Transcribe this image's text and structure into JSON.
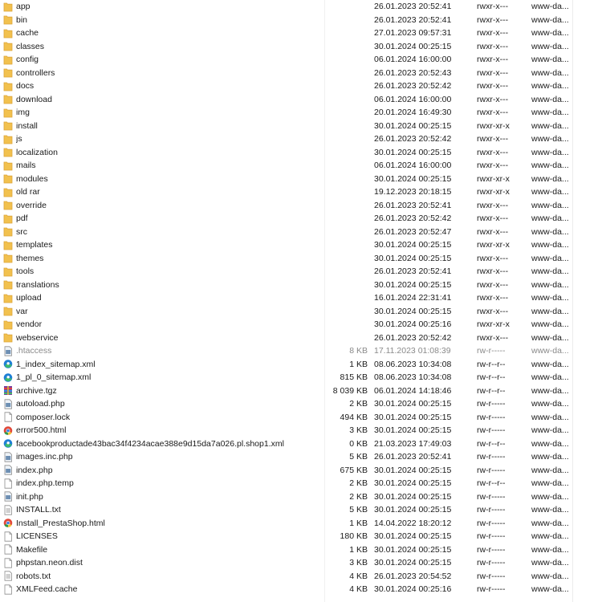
{
  "files": [
    {
      "name": "app",
      "size": "",
      "date": "26.01.2023 20:52:41",
      "perm": "rwxr-x---",
      "owner": "www-da...",
      "icon": "folder-icon"
    },
    {
      "name": "bin",
      "size": "",
      "date": "26.01.2023 20:52:41",
      "perm": "rwxr-x---",
      "owner": "www-da...",
      "icon": "folder-icon"
    },
    {
      "name": "cache",
      "size": "",
      "date": "27.01.2023 09:57:31",
      "perm": "rwxr-x---",
      "owner": "www-da...",
      "icon": "folder-icon"
    },
    {
      "name": "classes",
      "size": "",
      "date": "30.01.2024 00:25:15",
      "perm": "rwxr-x---",
      "owner": "www-da...",
      "icon": "folder-icon"
    },
    {
      "name": "config",
      "size": "",
      "date": "06.01.2024 16:00:00",
      "perm": "rwxr-x---",
      "owner": "www-da...",
      "icon": "folder-icon"
    },
    {
      "name": "controllers",
      "size": "",
      "date": "26.01.2023 20:52:43",
      "perm": "rwxr-x---",
      "owner": "www-da...",
      "icon": "folder-icon"
    },
    {
      "name": "docs",
      "size": "",
      "date": "26.01.2023 20:52:42",
      "perm": "rwxr-x---",
      "owner": "www-da...",
      "icon": "folder-icon"
    },
    {
      "name": "download",
      "size": "",
      "date": "06.01.2024 16:00:00",
      "perm": "rwxr-x---",
      "owner": "www-da...",
      "icon": "folder-icon"
    },
    {
      "name": "img",
      "size": "",
      "date": "20.01.2024 16:49:30",
      "perm": "rwxr-x---",
      "owner": "www-da...",
      "icon": "folder-icon"
    },
    {
      "name": "install",
      "size": "",
      "date": "30.01.2024 00:25:15",
      "perm": "rwxr-xr-x",
      "owner": "www-da...",
      "icon": "folder-icon"
    },
    {
      "name": "js",
      "size": "",
      "date": "26.01.2023 20:52:42",
      "perm": "rwxr-x---",
      "owner": "www-da...",
      "icon": "folder-icon"
    },
    {
      "name": "localization",
      "size": "",
      "date": "30.01.2024 00:25:15",
      "perm": "rwxr-x---",
      "owner": "www-da...",
      "icon": "folder-icon"
    },
    {
      "name": "mails",
      "size": "",
      "date": "06.01.2024 16:00:00",
      "perm": "rwxr-x---",
      "owner": "www-da...",
      "icon": "folder-icon"
    },
    {
      "name": "modules",
      "size": "",
      "date": "30.01.2024 00:25:15",
      "perm": "rwxr-xr-x",
      "owner": "www-da...",
      "icon": "folder-icon"
    },
    {
      "name": "old rar",
      "size": "",
      "date": "19.12.2023 20:18:15",
      "perm": "rwxr-xr-x",
      "owner": "www-da...",
      "icon": "folder-icon"
    },
    {
      "name": "override",
      "size": "",
      "date": "26.01.2023 20:52:41",
      "perm": "rwxr-x---",
      "owner": "www-da...",
      "icon": "folder-icon"
    },
    {
      "name": "pdf",
      "size": "",
      "date": "26.01.2023 20:52:42",
      "perm": "rwxr-x---",
      "owner": "www-da...",
      "icon": "folder-icon"
    },
    {
      "name": "src",
      "size": "",
      "date": "26.01.2023 20:52:47",
      "perm": "rwxr-x---",
      "owner": "www-da...",
      "icon": "folder-icon"
    },
    {
      "name": "templates",
      "size": "",
      "date": "30.01.2024 00:25:15",
      "perm": "rwxr-xr-x",
      "owner": "www-da...",
      "icon": "folder-icon"
    },
    {
      "name": "themes",
      "size": "",
      "date": "30.01.2024 00:25:15",
      "perm": "rwxr-x---",
      "owner": "www-da...",
      "icon": "folder-icon"
    },
    {
      "name": "tools",
      "size": "",
      "date": "26.01.2023 20:52:41",
      "perm": "rwxr-x---",
      "owner": "www-da...",
      "icon": "folder-icon"
    },
    {
      "name": "translations",
      "size": "",
      "date": "30.01.2024 00:25:15",
      "perm": "rwxr-x---",
      "owner": "www-da...",
      "icon": "folder-icon"
    },
    {
      "name": "upload",
      "size": "",
      "date": "16.01.2024 22:31:41",
      "perm": "rwxr-x---",
      "owner": "www-da...",
      "icon": "folder-icon"
    },
    {
      "name": "var",
      "size": "",
      "date": "30.01.2024 00:25:15",
      "perm": "rwxr-x---",
      "owner": "www-da...",
      "icon": "folder-icon"
    },
    {
      "name": "vendor",
      "size": "",
      "date": "30.01.2024 00:25:16",
      "perm": "rwxr-xr-x",
      "owner": "www-da...",
      "icon": "folder-icon"
    },
    {
      "name": "webservice",
      "size": "",
      "date": "26.01.2023 20:52:42",
      "perm": "rwxr-x---",
      "owner": "www-da...",
      "icon": "folder-icon"
    },
    {
      "name": ".htaccess",
      "size": "8 KB",
      "date": "17.11.2023 01:08:39",
      "perm": "rw-r-----",
      "owner": "www-da...",
      "icon": "generic-file-icon",
      "dimmed": true
    },
    {
      "name": "1_index_sitemap.xml",
      "size": "1 KB",
      "date": "08.06.2023 10:34:08",
      "perm": "rw-r--r--",
      "owner": "www-da...",
      "icon": "edge-browser-icon"
    },
    {
      "name": "1_pl_0_sitemap.xml",
      "size": "815 KB",
      "date": "08.06.2023 10:34:08",
      "perm": "rw-r--r--",
      "owner": "www-da...",
      "icon": "edge-browser-icon"
    },
    {
      "name": "archive.tgz",
      "size": "8 039 KB",
      "date": "06.01.2024 14:18:46",
      "perm": "rw-r--r--",
      "owner": "www-da...",
      "icon": "winrar-archive-icon"
    },
    {
      "name": "autoload.php",
      "size": "2 KB",
      "date": "30.01.2024 00:25:15",
      "perm": "rw-r-----",
      "owner": "www-da...",
      "icon": "generic-file-icon"
    },
    {
      "name": "composer.lock",
      "size": "494 KB",
      "date": "30.01.2024 00:25:15",
      "perm": "rw-r-----",
      "owner": "www-da...",
      "icon": "blank-file-icon"
    },
    {
      "name": "error500.html",
      "size": "3 KB",
      "date": "30.01.2024 00:25:15",
      "perm": "rw-r-----",
      "owner": "www-da...",
      "icon": "chrome-icon"
    },
    {
      "name": "facebookproductade43bac34f4234acae388e9d15da7a026.pl.shop1.xml",
      "size": "0 KB",
      "date": "21.03.2023 17:49:03",
      "perm": "rw-r--r--",
      "owner": "www-da...",
      "icon": "edge-browser-icon"
    },
    {
      "name": "images.inc.php",
      "size": "5 KB",
      "date": "26.01.2023 20:52:41",
      "perm": "rw-r-----",
      "owner": "www-da...",
      "icon": "generic-file-icon"
    },
    {
      "name": "index.php",
      "size": "675 KB",
      "date": "30.01.2024 00:25:15",
      "perm": "rw-r-----",
      "owner": "www-da...",
      "icon": "generic-file-icon"
    },
    {
      "name": "index.php.temp",
      "size": "2 KB",
      "date": "30.01.2024 00:25:15",
      "perm": "rw-r--r--",
      "owner": "www-da...",
      "icon": "blank-file-icon"
    },
    {
      "name": "init.php",
      "size": "2 KB",
      "date": "30.01.2024 00:25:15",
      "perm": "rw-r-----",
      "owner": "www-da...",
      "icon": "generic-file-icon"
    },
    {
      "name": "INSTALL.txt",
      "size": "5 KB",
      "date": "30.01.2024 00:25:15",
      "perm": "rw-r-----",
      "owner": "www-da...",
      "icon": "text-file-icon"
    },
    {
      "name": "Install_PrestaShop.html",
      "size": "1 KB",
      "date": "14.04.2022 18:20:12",
      "perm": "rw-r-----",
      "owner": "www-da...",
      "icon": "chrome-icon"
    },
    {
      "name": "LICENSES",
      "size": "180 KB",
      "date": "30.01.2024 00:25:15",
      "perm": "rw-r-----",
      "owner": "www-da...",
      "icon": "blank-file-icon"
    },
    {
      "name": "Makefile",
      "size": "1 KB",
      "date": "30.01.2024 00:25:15",
      "perm": "rw-r-----",
      "owner": "www-da...",
      "icon": "blank-file-icon"
    },
    {
      "name": "phpstan.neon.dist",
      "size": "3 KB",
      "date": "30.01.2024 00:25:15",
      "perm": "rw-r-----",
      "owner": "www-da...",
      "icon": "blank-file-icon"
    },
    {
      "name": "robots.txt",
      "size": "4 KB",
      "date": "26.01.2023 20:54:52",
      "perm": "rw-r-----",
      "owner": "www-da...",
      "icon": "text-file-icon"
    },
    {
      "name": "XMLFeed.cache",
      "size": "4 KB",
      "date": "30.01.2024 00:25:16",
      "perm": "rw-r-----",
      "owner": "www-da...",
      "icon": "blank-file-icon"
    }
  ],
  "colors": {
    "folder": "#f2c14e",
    "folder_dark": "#dca53a",
    "file_border": "#8e8e8e",
    "generic_file": "#6d8fb3",
    "edge_blue": "#1f7fd6",
    "edge_green": "#3dbb6b",
    "chrome_red": "#e04a3b",
    "chrome_yellow": "#f5c33b",
    "chrome_green": "#2e9b4b",
    "chrome_blue": "#3b7de0",
    "rar_purple": "#7a3fa0"
  }
}
